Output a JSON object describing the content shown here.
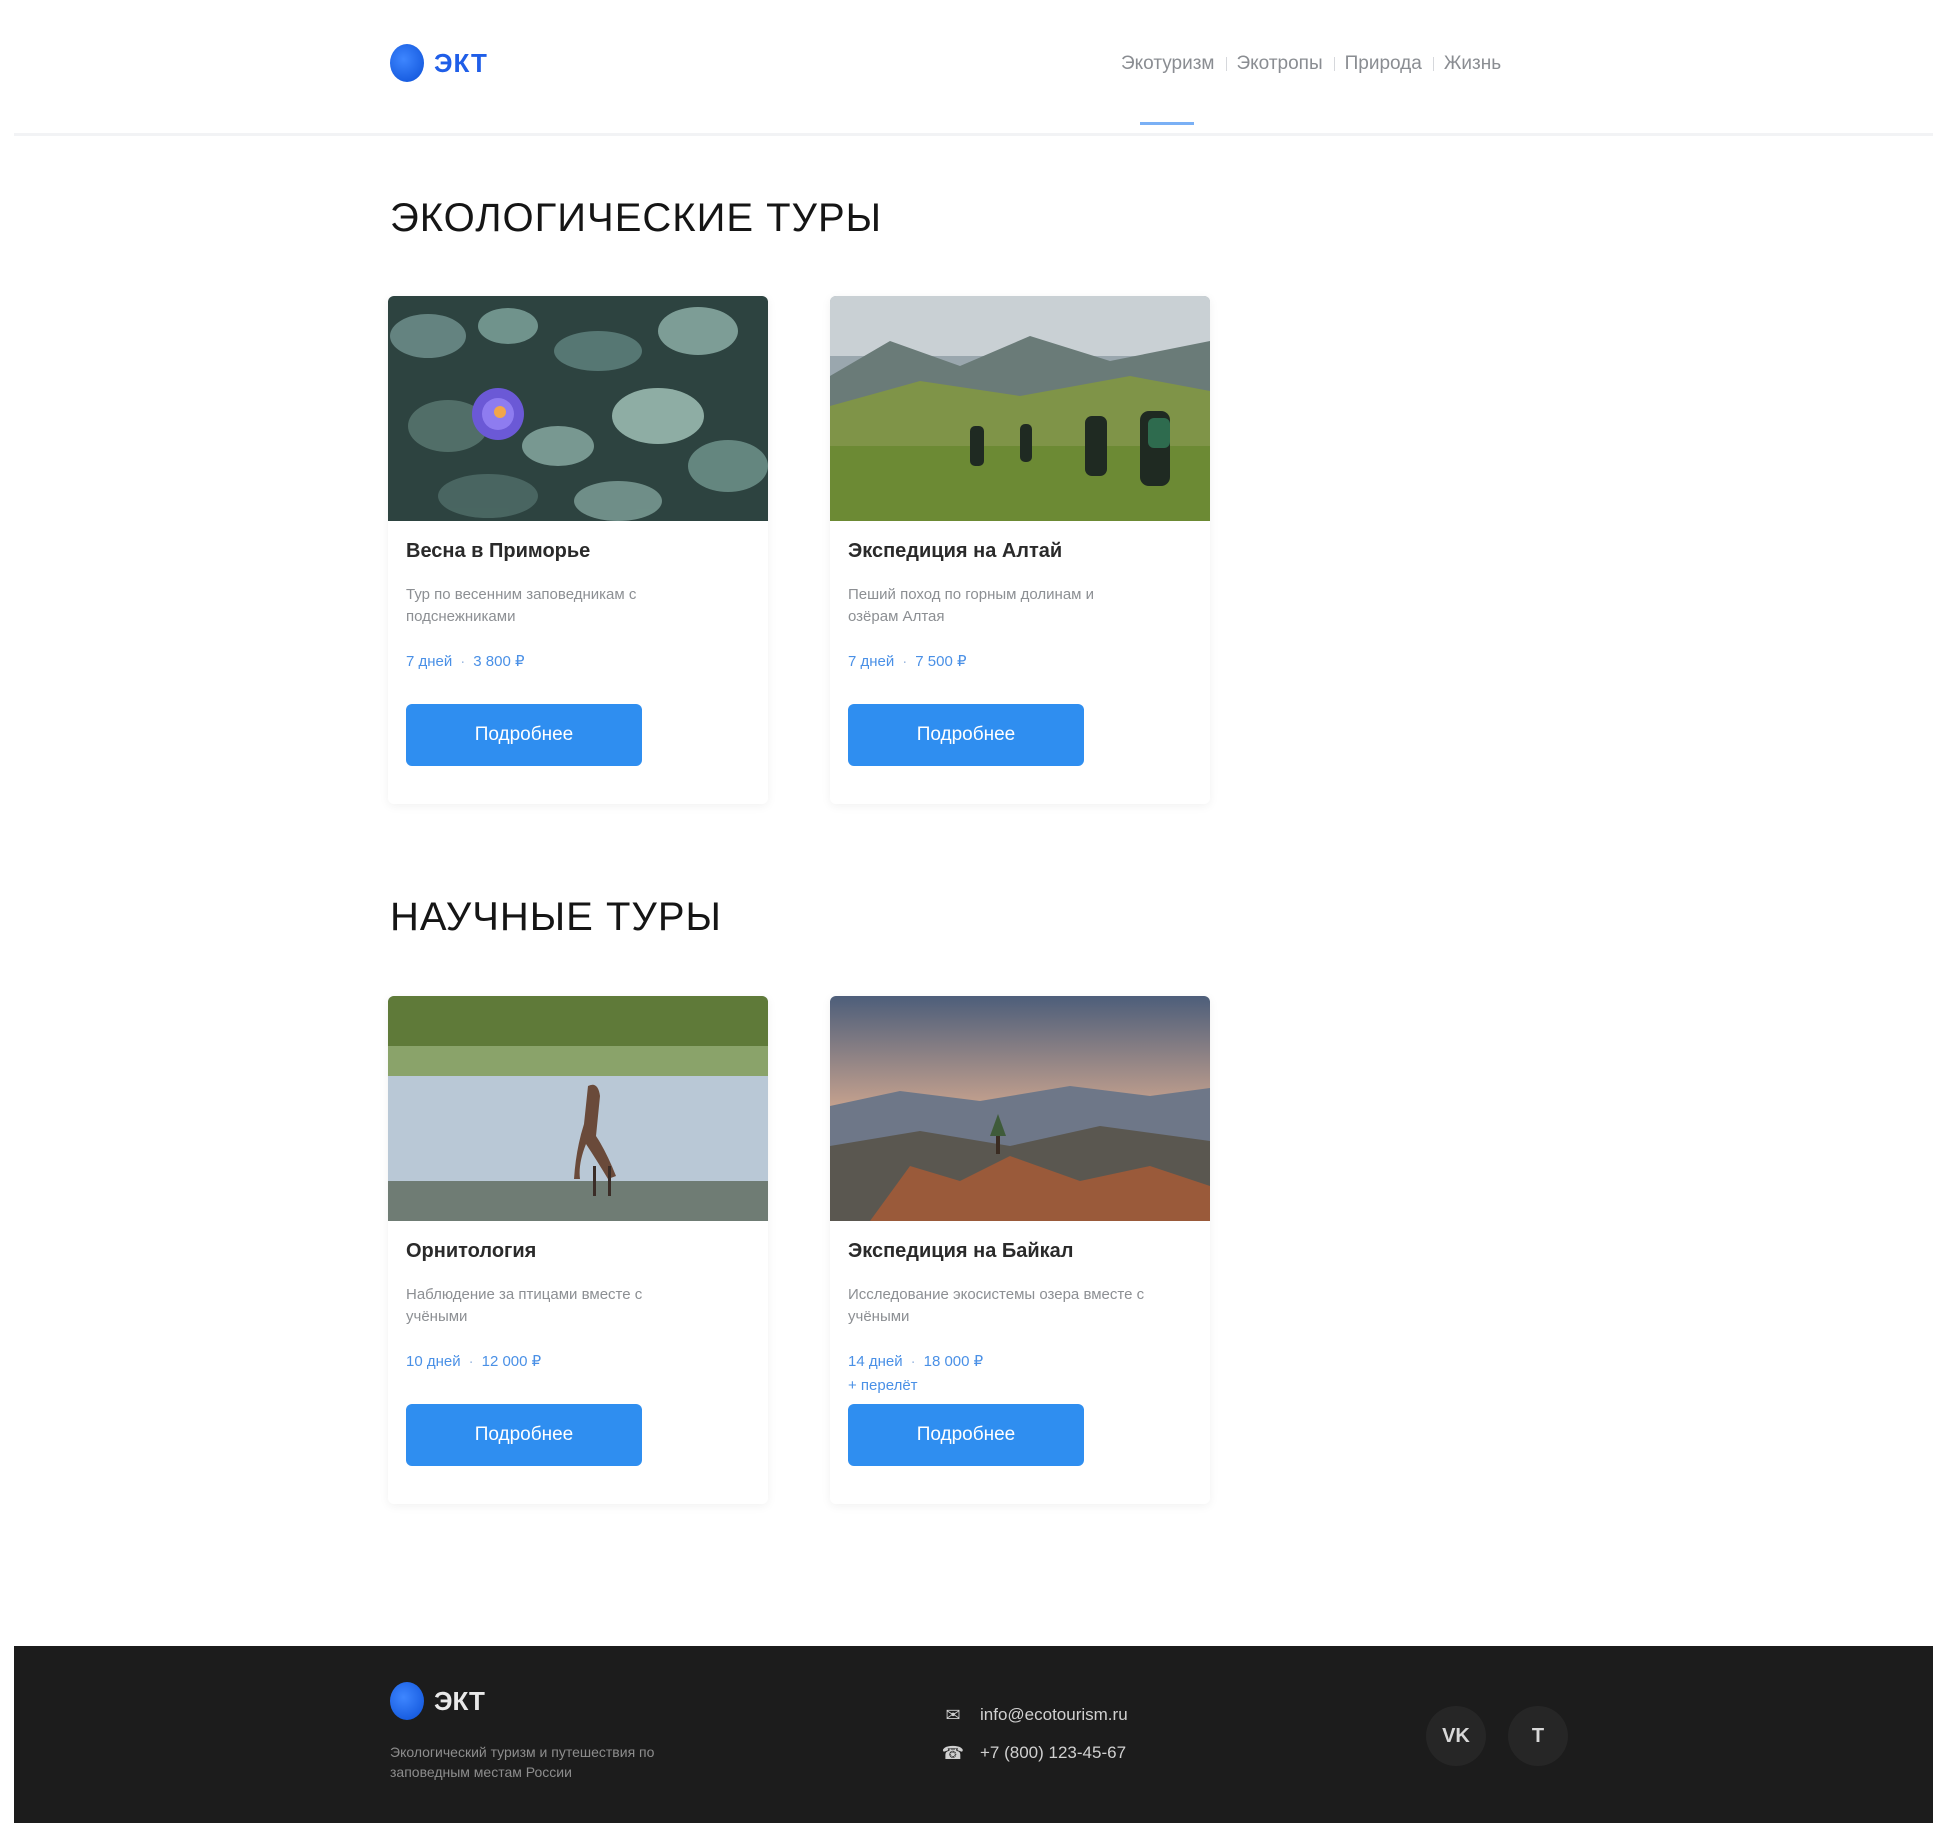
{
  "brand": {
    "name": "ЭКТ",
    "accent_color": "#2f8ef0",
    "logo_color": "#1f5ee8"
  },
  "nav": {
    "items": [
      {
        "label": "Экотуризм",
        "active": true
      },
      {
        "label": "Экотропы"
      },
      {
        "label": "Природа"
      },
      {
        "label": "Жизнь"
      }
    ]
  },
  "sections": [
    {
      "title": "ЭКОЛОГИЧЕСКИЕ ТУРЫ",
      "cards": [
        {
          "image": "spring-flower-photo",
          "title": "Весна в Приморье",
          "description": "Тур по весенним заповедникам с подснежниками",
          "meta": [
            "7 дней",
            "3 800 ₽"
          ],
          "button": "Подробнее"
        },
        {
          "image": "hikers-in-mountain-valley-photo",
          "title": "Экспедиция на Алтай",
          "description": "Пеший поход по горным долинам и озёрам Алтая",
          "meta": [
            "7 дней",
            "7 500 ₽"
          ],
          "button": "Подробнее"
        }
      ]
    },
    {
      "title": "НАУЧНЫЕ ТУРЫ",
      "cards": [
        {
          "image": "heron-in-water-photo",
          "title": "Орнитология",
          "description": "Наблюдение за птицами вместе с учёными",
          "meta": [
            "10 дней",
            "12 000 ₽"
          ],
          "button": "Подробнее"
        },
        {
          "image": "sunset-mountain-ridge-photo",
          "title": "Экспедиция на Байкал",
          "description": "Исследование экосистемы озера вместе с учёными",
          "meta": [
            "14 дней",
            "18 000 ₽",
            "+ перелёт"
          ],
          "button": "Подробнее"
        }
      ]
    }
  ],
  "footer": {
    "brand": "ЭКТ",
    "about": "Экологический туризм и путешествия по заповедным местам России",
    "contacts": [
      {
        "icon": "mail-icon",
        "text": "info@ecotourism.ru"
      },
      {
        "icon": "phone-icon",
        "text": "+7 (800) 123-45-67"
      }
    ],
    "social": [
      {
        "icon": "vk-icon",
        "label": "VK"
      },
      {
        "icon": "telegram-icon",
        "label": "T"
      }
    ]
  }
}
